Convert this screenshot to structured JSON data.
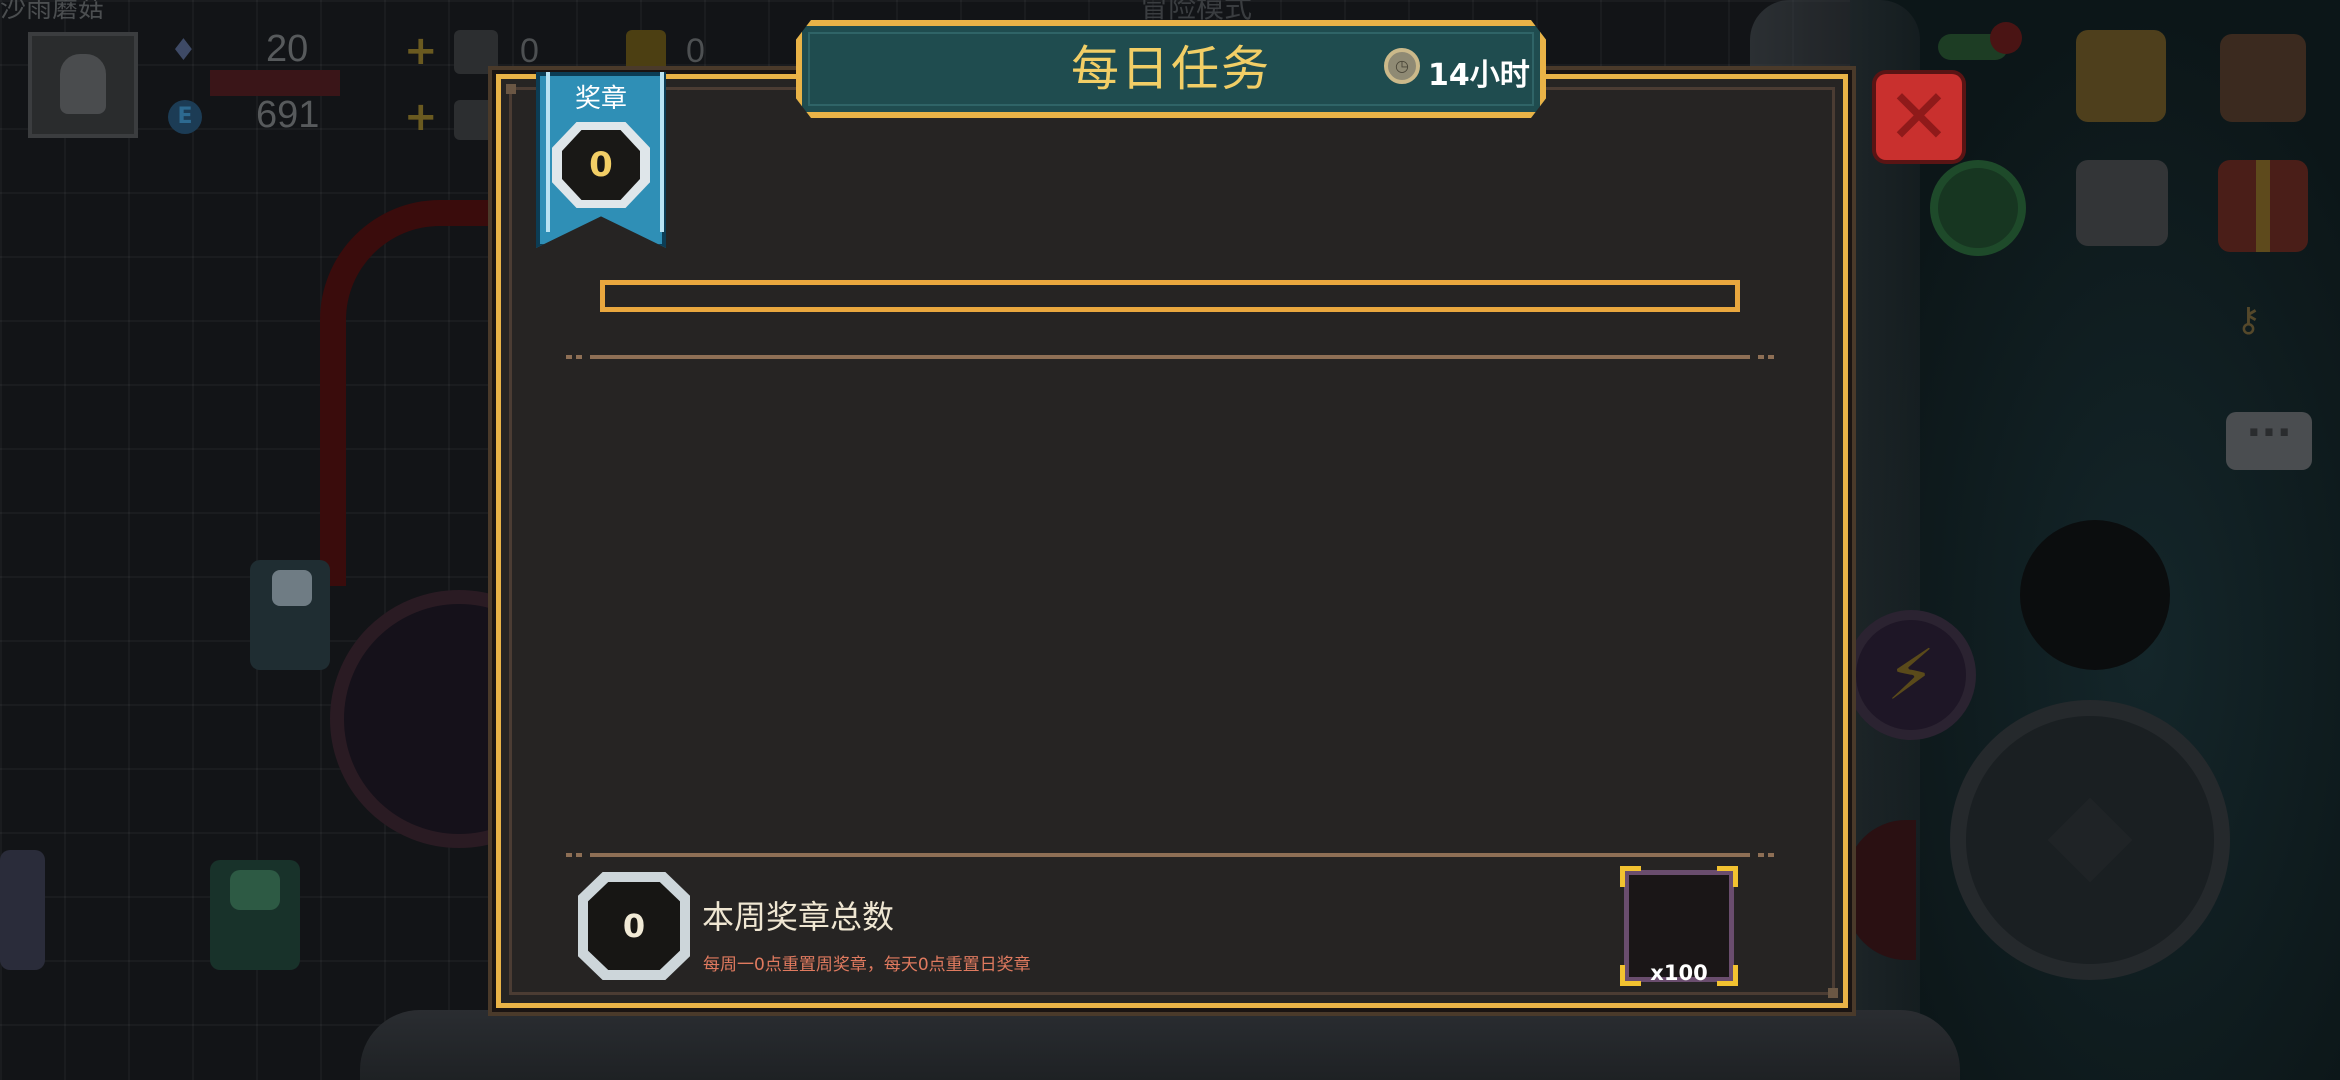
{
  "hud": {
    "player_name": "沙雨蘑菇",
    "gems": "20",
    "energy": "691",
    "material_count_1": "0",
    "material_count_2": "0",
    "mode_label": "冒险模式"
  },
  "dialog": {
    "title": "每日任务",
    "timer": "14小时",
    "timer_icon": "clock-coin-icon",
    "close_icon": "close-icon",
    "medal_label": "奖章",
    "medal_count": "0",
    "progress": 0,
    "weekly_count": "0",
    "weekly_title": "本周奖章总数",
    "weekly_note": "每周一0点重置周奖章，每天0点重置日奖章",
    "reward_quantity": "x100"
  },
  "colors": {
    "frame_gold": "#e9b347",
    "banner_teal": "#1f4c4f",
    "title_text": "#f2ce66",
    "panel_bg": "#262423",
    "close_red": "#c9302e",
    "ribbon_blue": "#2f8fb6",
    "note_text": "#e07a5f",
    "reward_border": "#6a4d6e"
  }
}
